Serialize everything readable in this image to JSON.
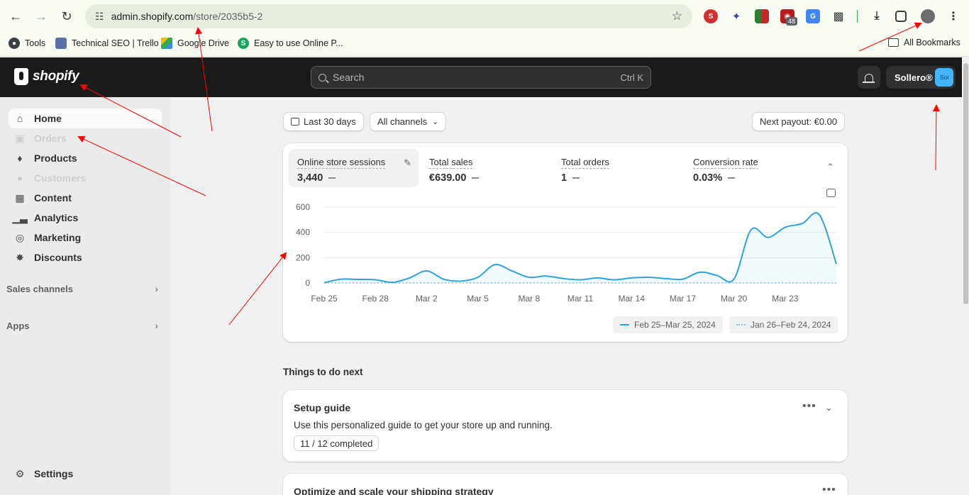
{
  "browser": {
    "url_host": "admin.shopify.com",
    "url_path": "/store/2035b5-2",
    "bookmarks": [
      {
        "label": "Tools"
      },
      {
        "label": "Technical SEO | Trello"
      },
      {
        "label": "Google Drive"
      },
      {
        "label": "Easy to use Online P..."
      }
    ],
    "all_bookmarks": "All Bookmarks",
    "extension_badge": "48"
  },
  "topbar": {
    "logo_text": "shopify",
    "search_placeholder": "Search",
    "search_shortcut": "Ctrl K",
    "store_name": "Sollero®",
    "store_avatar": "Sol"
  },
  "sidebar": {
    "items": [
      {
        "label": "Home"
      },
      {
        "label": "Orders"
      },
      {
        "label": "Products"
      },
      {
        "label": "Customers"
      },
      {
        "label": "Content"
      },
      {
        "label": "Analytics"
      },
      {
        "label": "Marketing"
      },
      {
        "label": "Discounts"
      }
    ],
    "sales_channels": "Sales channels",
    "apps": "Apps",
    "settings": "Settings"
  },
  "filters": {
    "date_range": "Last 30 days",
    "channels": "All channels",
    "payout": "Next payout: €0.00"
  },
  "metrics": [
    {
      "label": "Online store sessions",
      "value": "3,440"
    },
    {
      "label": "Total sales",
      "value": "€639.00"
    },
    {
      "label": "Total orders",
      "value": "1"
    },
    {
      "label": "Conversion rate",
      "value": "0.03%"
    }
  ],
  "chart_data": {
    "type": "line",
    "x_ticks": [
      "Feb 25",
      "Feb 28",
      "Mar 2",
      "Mar 5",
      "Mar 8",
      "Mar 11",
      "Mar 14",
      "Mar 17",
      "Mar 20",
      "Mar 23"
    ],
    "y_ticks": [
      0,
      200,
      400,
      600
    ],
    "ylim": [
      0,
      600
    ],
    "series": [
      {
        "name": "Feb 25–Mar 25, 2024",
        "style": "solid",
        "color": "#2fa3da",
        "values": [
          2,
          30,
          28,
          25,
          5,
          40,
          95,
          30,
          15,
          45,
          145,
          95,
          45,
          55,
          35,
          25,
          40,
          25,
          40,
          45,
          35,
          30,
          85,
          60,
          30,
          420,
          360,
          440,
          470,
          540,
          150
        ]
      },
      {
        "name": "Jan 26–Feb 24, 2024",
        "style": "dotted",
        "color": "#7fc6e8",
        "values": [
          0,
          0,
          0,
          0,
          0,
          0,
          0,
          0,
          0,
          0,
          0,
          0,
          0,
          0,
          0,
          0,
          0,
          0,
          0,
          0,
          0,
          0,
          0,
          0,
          0,
          0,
          0,
          0,
          0,
          0,
          0
        ]
      }
    ],
    "legend_placement": "bottom-right"
  },
  "todo": {
    "title": "Things to do next",
    "setup_title": "Setup guide",
    "setup_desc": "Use this personalized guide to get your store up and running.",
    "setup_progress": "11 / 12 completed",
    "shipping_title": "Optimize and scale your shipping strategy"
  }
}
